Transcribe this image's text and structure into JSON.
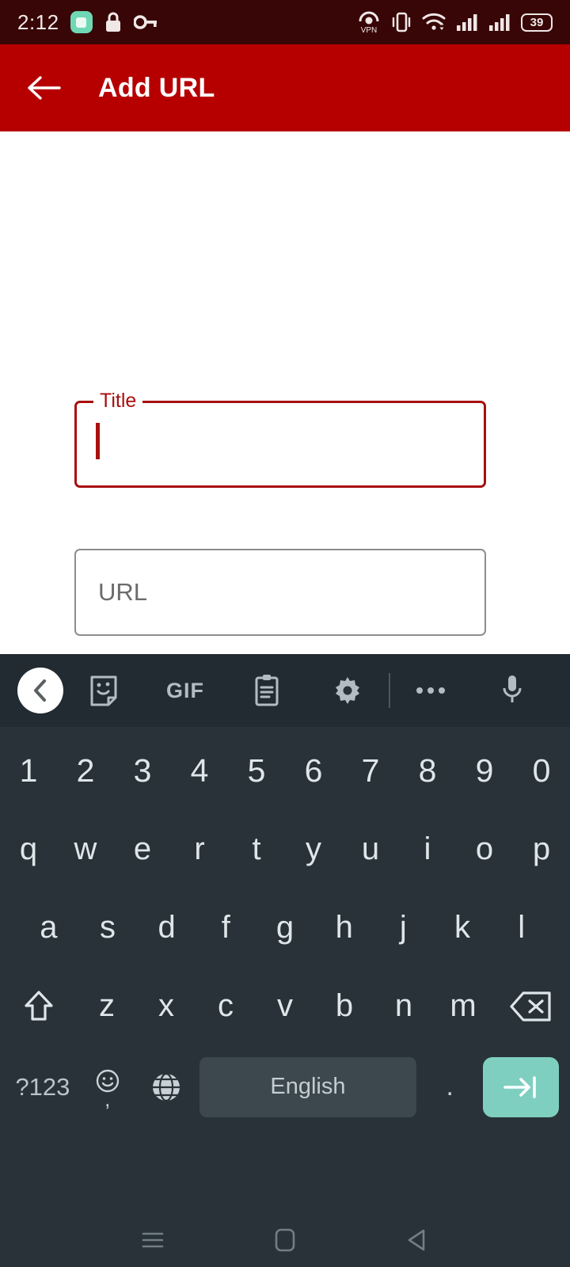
{
  "status_bar": {
    "time": "2:12",
    "battery_percent": "39",
    "left_icons": [
      "app-notification-icon",
      "lock-icon",
      "key-icon"
    ],
    "right_icons": [
      "vpn-icon",
      "vibrate-icon",
      "wifi-icon",
      "signal-sim1-icon",
      "signal-sim2-icon",
      "battery-icon"
    ],
    "background_color": "#380606"
  },
  "app_bar": {
    "title": "Add URL",
    "back_icon": "arrow-left-icon",
    "background_color": "#b60000",
    "text_color": "#ffffff"
  },
  "form": {
    "title_field": {
      "label": "Title",
      "value": "",
      "focused": true,
      "accent_color": "#a80f0f"
    },
    "url_field": {
      "placeholder": "URL",
      "value": "",
      "focused": false,
      "border_color": "#8d8d8d"
    }
  },
  "keyboard": {
    "background_color": "#283238",
    "toolbar": {
      "back_icon": "chevron-left-icon",
      "items": [
        {
          "icon": "sticker-icon",
          "label": ""
        },
        {
          "icon": "gif-icon",
          "label": "GIF"
        },
        {
          "icon": "clipboard-icon",
          "label": ""
        },
        {
          "icon": "gear-icon",
          "label": ""
        }
      ],
      "overflow_icon": "more-horizontal-icon",
      "mic_icon": "microphone-icon"
    },
    "rows": {
      "numbers": [
        "1",
        "2",
        "3",
        "4",
        "5",
        "6",
        "7",
        "8",
        "9",
        "0"
      ],
      "top": [
        "q",
        "w",
        "e",
        "r",
        "t",
        "y",
        "u",
        "i",
        "o",
        "p"
      ],
      "middle": [
        "a",
        "s",
        "d",
        "f",
        "g",
        "h",
        "j",
        "k",
        "l"
      ],
      "bottom": [
        "z",
        "x",
        "c",
        "v",
        "b",
        "n",
        "m"
      ],
      "shift_icon": "shift-icon",
      "backspace_icon": "backspace-icon"
    },
    "bottom_row": {
      "symbols_key": "?123",
      "emoji_icon": "emoji-icon",
      "comma_key": ",",
      "language_icon": "globe-icon",
      "space_key": "English",
      "period_key": ".",
      "enter_icon": "tab-next-icon",
      "enter_color": "#7fcfc0"
    }
  },
  "nav_bar": {
    "recents_icon": "recents-icon",
    "home_icon": "home-icon",
    "back_icon": "nav-back-icon",
    "background_color": "#283238"
  }
}
